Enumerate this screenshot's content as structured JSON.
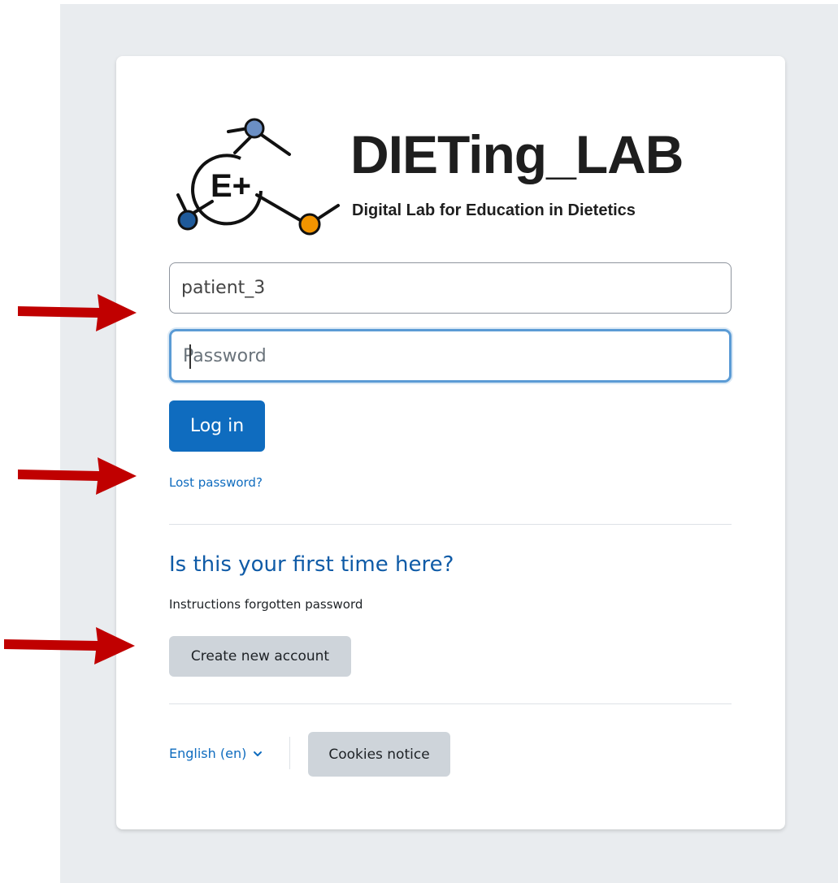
{
  "logo": {
    "title": "DIETing_LAB",
    "subtitle": "Digital Lab for Education in Dietetics",
    "badge": "E+"
  },
  "login": {
    "username_value": "patient_3",
    "password_placeholder": "Password",
    "login_label": "Log in",
    "lost_password_label": "Lost password?"
  },
  "signup": {
    "heading": "Is this your first time here?",
    "instructions": "Instructions forgotten password",
    "create_account_label": "Create new account"
  },
  "footer": {
    "language_label": "English (en)",
    "cookies_label": "Cookies notice"
  },
  "colors": {
    "primary": "#0f6cbf",
    "heading": "#0f5ba7",
    "secondary_button": "#ced4da",
    "annotation_arrow": "#c00000",
    "logo_node_blue": "#6b8fc4",
    "logo_node_dark_blue": "#1f5a9a",
    "logo_node_orange": "#f29400"
  },
  "icons": {
    "language_dropdown": "chevron-down-icon",
    "annotation": "red-arrow-icon"
  }
}
